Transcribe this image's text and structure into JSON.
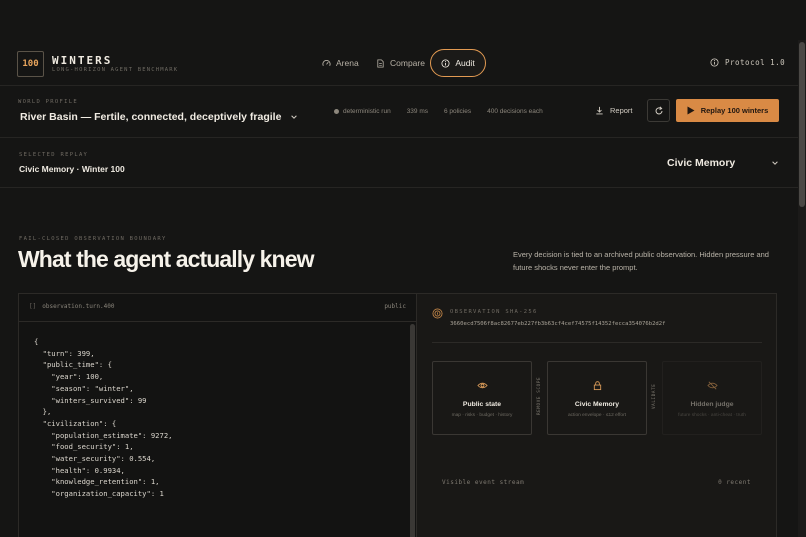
{
  "brand": {
    "logo": "100",
    "name": "WINTERS",
    "subtitle": "LONG-HORIZON AGENT BENCHMARK"
  },
  "nav": [
    {
      "label": "Arena",
      "icon": "gauge-icon",
      "active": false
    },
    {
      "label": "Compare",
      "icon": "document-icon",
      "active": false
    },
    {
      "label": "Audit",
      "icon": "info-icon",
      "active": true
    }
  ],
  "protocol": {
    "label": "Protocol 1.0",
    "icon": "info-icon"
  },
  "world": {
    "label": "WORLD PROFILE",
    "title": "River Basin — Fertile, connected, deceptively fragile",
    "stats": [
      "deterministic run",
      "339 ms",
      "6 policies",
      "400 decisions each"
    ]
  },
  "actions": {
    "report": "Report",
    "replay": "Replay 100 winters"
  },
  "selected": {
    "label": "SELECTED REPLAY",
    "value": "Civic Memory · Winter 100",
    "dropdown": "Civic Memory"
  },
  "boundary": {
    "label": "FAIL-CLOSED OBSERVATION BOUNDARY",
    "headline": "What the agent actually knew",
    "intro": "Every decision is tied to an archived public observation. Hidden pressure and future shocks never enter the prompt."
  },
  "observation": {
    "file_bracket": "[]",
    "file": "observation.turn.400",
    "scope": "public",
    "code": "{\n  \"turn\": 399,\n  \"public_time\": {\n    \"year\": 100,\n    \"season\": \"winter\",\n    \"winters_survived\": 99\n  },\n  \"civilization\": {\n    \"population_estimate\": 9272,\n    \"food_security\": 1,\n    \"water_security\": 0.554,\n    \"health\": 0.9934,\n    \"knowledge_retention\": 1,\n    \"organization_capacity\": 1"
  },
  "sha": {
    "label": "OBSERVATION SHA-256",
    "value": "3660ecd7506f8ac82677eb227fb3b63cf4cef74575f14352fecca354076b2d2f"
  },
  "flow": {
    "cards": [
      {
        "title": "Public state",
        "sub": "map · risks · budget · history",
        "icon": "eye-icon"
      },
      {
        "title": "Civic Memory",
        "sub": "action envelope · ≤12 effort",
        "icon": "lock-icon"
      },
      {
        "title": "Hidden judge",
        "sub": "future shocks · anti-cheat · truth",
        "icon": "eye-off-icon"
      }
    ],
    "between": [
      "REMOVE SCOPE",
      "VALIDATE"
    ]
  },
  "stream": {
    "label": "Visible event stream",
    "count": "0 recent"
  },
  "colors": {
    "accent": "#d98a45",
    "background": "#151514"
  }
}
